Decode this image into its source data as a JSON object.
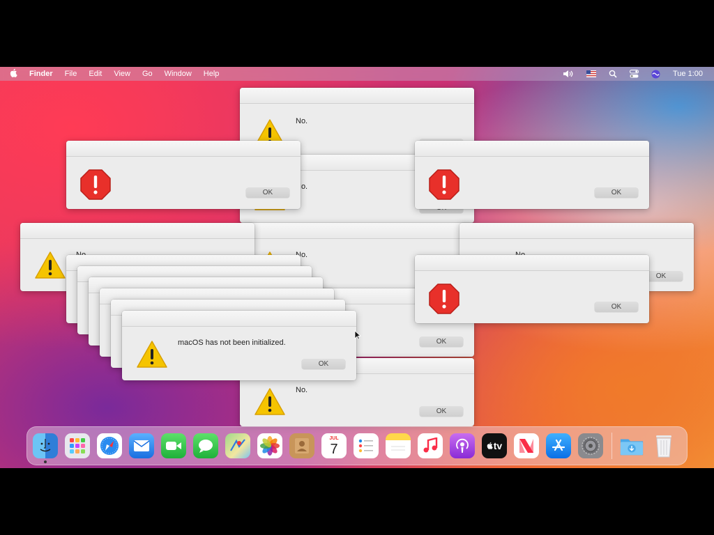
{
  "menubar": {
    "apple": "",
    "app_name": "Finder",
    "menus": [
      "File",
      "Edit",
      "View",
      "Go",
      "Window",
      "Help"
    ],
    "clock": "Tue 1:00",
    "status_icons": [
      "volume-icon",
      "flag-us-icon",
      "spotlight-icon",
      "control-center-icon",
      "siri-icon"
    ]
  },
  "dialogs": {
    "no": "No.",
    "ok": "OK",
    "not_initialized": "macOS has not been initialized."
  },
  "dock": {
    "apps": [
      "Finder",
      "Launchpad",
      "Safari",
      "Mail",
      "FaceTime",
      "Messages",
      "Maps",
      "Photos",
      "Contacts",
      "Calendar",
      "Reminders",
      "Notes",
      "Music",
      "Podcasts",
      "TV",
      "News",
      "App Store",
      "System Preferences"
    ],
    "calendar_month": "JUL",
    "calendar_day": "7",
    "tv_label": "tv",
    "extras": [
      "Downloads",
      "Trash"
    ]
  }
}
